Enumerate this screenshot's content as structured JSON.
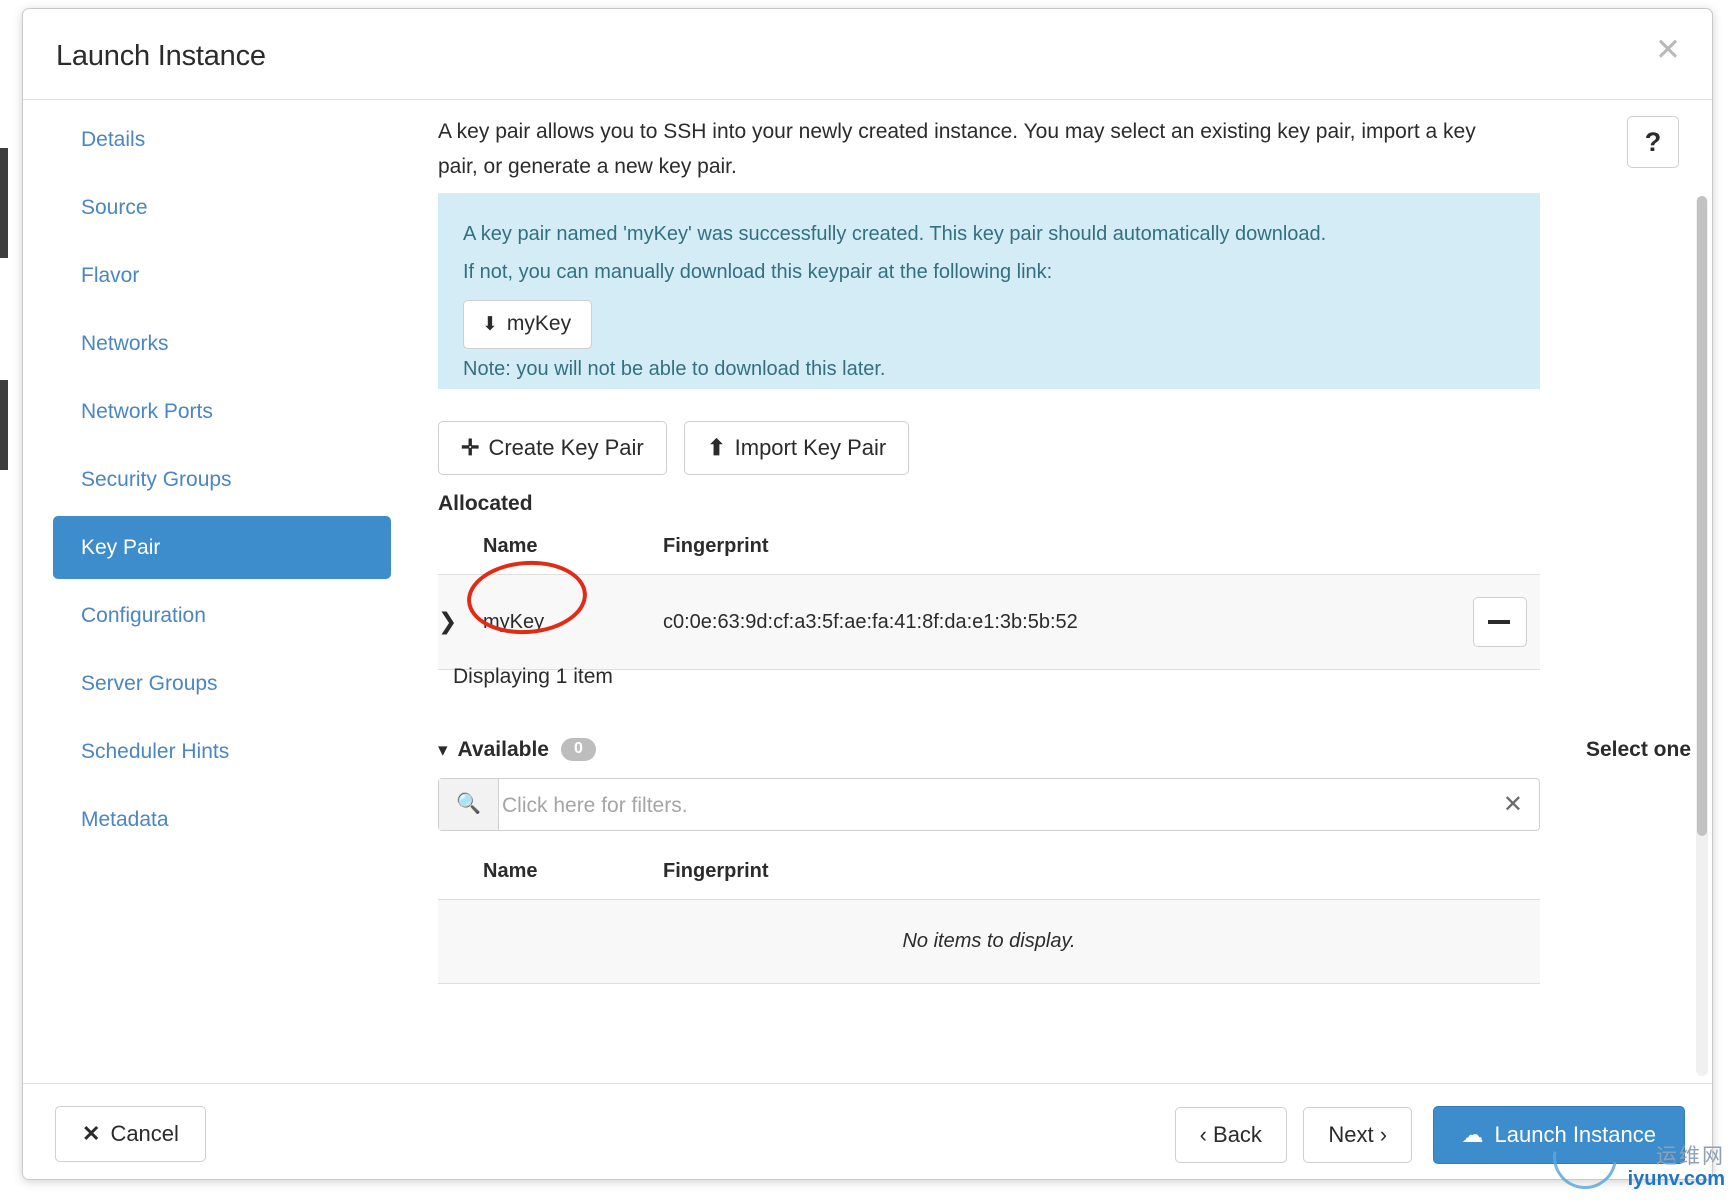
{
  "window": {
    "title": "Launch Instance",
    "close_icon": "close-icon"
  },
  "sidebar": {
    "items": [
      {
        "label": "Details",
        "active": false
      },
      {
        "label": "Source",
        "active": false
      },
      {
        "label": "Flavor",
        "active": false
      },
      {
        "label": "Networks",
        "active": false
      },
      {
        "label": "Network Ports",
        "active": false
      },
      {
        "label": "Security Groups",
        "active": false
      },
      {
        "label": "Key Pair",
        "active": true
      },
      {
        "label": "Configuration",
        "active": false
      },
      {
        "label": "Server Groups",
        "active": false
      },
      {
        "label": "Scheduler Hints",
        "active": false
      },
      {
        "label": "Metadata",
        "active": false
      }
    ]
  },
  "content": {
    "help_label": "?",
    "intro": "A key pair allows you to SSH into your newly created instance. You may select an existing key pair, import a key pair, or generate a new key pair.",
    "alert": {
      "line1": "A key pair named 'myKey' was successfully created. This key pair should automatically download.",
      "line2": "If not, you can manually download this keypair at the following link:",
      "download_label": "myKey",
      "download_icon": "download-icon",
      "note": "Note: you will not be able to download this later.",
      "background_color": "#d4ecf6",
      "text_color": "#33707f"
    },
    "actions": {
      "create_label": "Create Key Pair",
      "create_icon": "plus-icon",
      "import_label": "Import Key Pair",
      "import_icon": "upload-icon"
    },
    "allocated": {
      "title": "Allocated",
      "columns": [
        "Name",
        "Fingerprint"
      ],
      "rows": [
        {
          "arrow": "❯",
          "name": "myKey",
          "fingerprint": "c0:0e:63:9d:cf:a3:5f:ae:fa:41:8f:da:e1:3b:5b:52"
        }
      ],
      "footer": "Displaying 1 item",
      "annotation_color": "#e02b16"
    },
    "available": {
      "title": "Available",
      "count": "0",
      "chevron": "⌄",
      "select_hint": "Select one",
      "filter_placeholder": "Click here for filters.",
      "filter_value": "",
      "filter_icon": "search-icon",
      "clear_icon": "clear-icon",
      "columns": [
        "Name",
        "Fingerprint"
      ],
      "empty_text": "No items to display."
    }
  },
  "footer": {
    "cancel_label": "Cancel",
    "cancel_icon": "x-icon",
    "back_label": "‹ Back",
    "next_label": "Next ›",
    "launch_label": "Launch Instance",
    "launch_icon": "cloud-upload-icon",
    "primary_color": "#3d8ccc"
  },
  "watermark": {
    "cn": "运维网",
    "en": "iyunv.com"
  }
}
